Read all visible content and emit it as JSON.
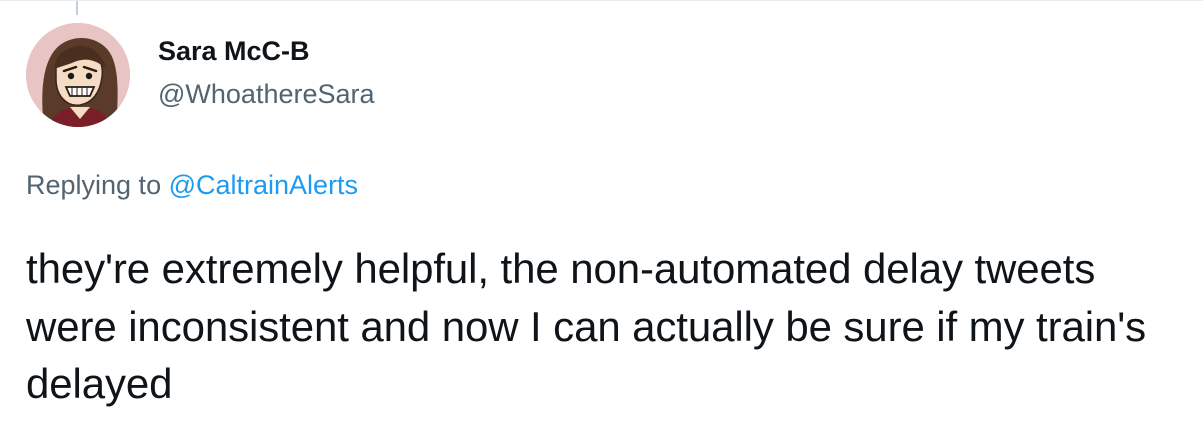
{
  "tweet": {
    "author": {
      "display_name": "Sara McC-B",
      "handle": "@WhoathereSara"
    },
    "reply": {
      "prefix": "Replying to ",
      "mention": "@CaltrainAlerts"
    },
    "text": "they're extremely helpful, the non-automated delay tweets were inconsistent and now I can actually be sure if my train's delayed"
  },
  "colors": {
    "text_primary": "#0f1419",
    "text_secondary": "#536471",
    "link": "#1d9bf0",
    "avatar_bg": "#e8c4c4"
  },
  "icons": {
    "avatar": "cartoon-portrait-avatar"
  }
}
